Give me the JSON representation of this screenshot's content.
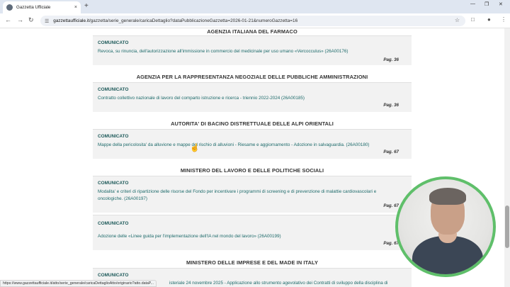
{
  "browser": {
    "tab_title": "Gazzetta Ufficiale",
    "tab_close": "×",
    "new_tab": "+",
    "url_host": "gazzettaufficiale.it",
    "url_path": "/gazzetta/serie_generale/caricaDettaglio?dataPubblicazioneGazzetta=2026-01-21&numeroGazzetta=16",
    "status_url": "https://www.gazzettaufficiale.it/atto/serie_generale/caricaDettaglioAtto/originario?atto.dataP..."
  },
  "sections": [
    {
      "title": "AGENZIA ITALIANA DEL FARMACO",
      "entries": [
        {
          "kind": "COMUNICATO",
          "text": "Revoca, su rinuncia, dell'autorizzazione all'immissione in commercio del medicinale per uso umano «Vercocculus» (26A00176)",
          "page": "Pag. 36"
        }
      ]
    },
    {
      "title": "AGENZIA PER LA RAPPRESENTANZA NEGOZIALE DELLE PUBBLICHE AMMINISTRAZIONI",
      "entries": [
        {
          "kind": "COMUNICATO",
          "text": "Contratto collettivo nazionale di lavoro del comparto istruzione e ricerca - triennio 2022-2024 (26A00185)",
          "page": "Pag. 36"
        }
      ]
    },
    {
      "title": "AUTORITA' DI BACINO DISTRETTUALE DELLE ALPI ORIENTALI",
      "entries": [
        {
          "kind": "COMUNICATO",
          "text": "Mappe della pericolosita' da alluvione e mappe del rischio di alluvioni - Riesame e aggiornamento - Adozione in salvaguardia. (26A00180)",
          "page": "Pag. 67"
        }
      ]
    },
    {
      "title": "MINISTERO DEL LAVORO E DELLE POLITICHE SOCIALI",
      "entries": [
        {
          "kind": "COMUNICATO",
          "text": "Modalita' e criteri di ripartizione delle risorse del Fondo per incentivare i programmi di screening e di prevenzione di malattie cardiovascolari e oncologiche. (26A00197)",
          "page": "Pag. 67"
        },
        {
          "kind": "COMUNICATO",
          "text": "Adozione delle «Linee guida per l'implementazione dell'IA nel mondo del lavoro» (26A00199)",
          "page": "Pag. 67"
        }
      ]
    },
    {
      "title": "MINISTERO DELLE IMPRESE E DEL MADE IN ITALY",
      "entries": [
        {
          "kind": "COMUNICATO",
          "text": "isteriale 24 novembre 2025 - Applicazione allo strumento agevolativo dei Contratti di sviluppo della disciplina di",
          "page": ""
        }
      ]
    }
  ],
  "colors": {
    "link": "#1e6b6b",
    "card_bg": "#f2f2f2",
    "webcam_ring": "#5fbf6a"
  }
}
